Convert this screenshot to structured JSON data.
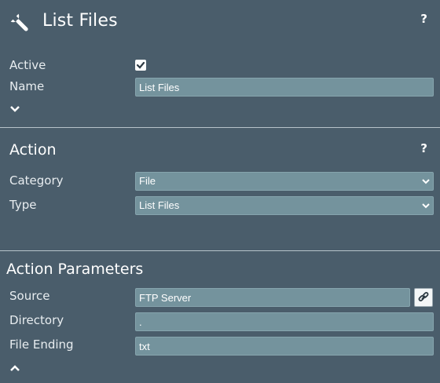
{
  "header": {
    "title": "List Files",
    "help": "?"
  },
  "general": {
    "active_label": "Active",
    "active_checked": true,
    "name_label": "Name",
    "name_value": "List Files"
  },
  "action": {
    "title": "Action",
    "help": "?",
    "category_label": "Category",
    "category_value": "File",
    "type_label": "Type",
    "type_value": "List Files"
  },
  "parameters": {
    "title": "Action Parameters",
    "source_label": "Source",
    "source_value": "FTP Server",
    "directory_label": "Directory",
    "directory_value": ".",
    "file_ending_label": "File Ending",
    "file_ending_value": "txt"
  },
  "icons": {
    "header": "wrench-icon",
    "expand": "chevron-down-icon",
    "collapse": "chevron-up-icon",
    "link": "link-icon",
    "check": "checkmark-icon"
  },
  "colors": {
    "background": "#4a5d6b",
    "field": "#74939d",
    "divider": "#b7c3ca"
  }
}
